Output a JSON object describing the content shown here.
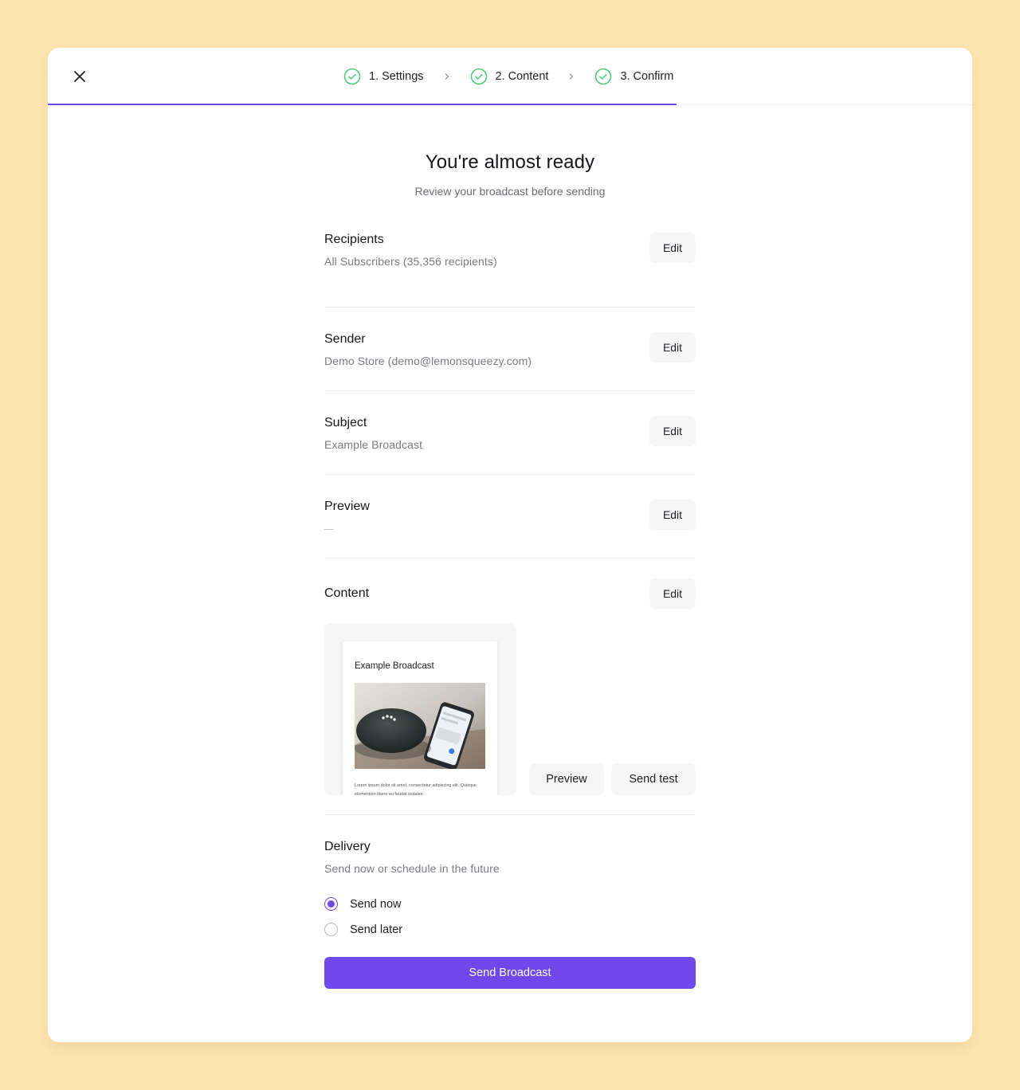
{
  "header": {
    "steps": [
      {
        "label": "1. Settings"
      },
      {
        "label": "2. Content"
      },
      {
        "label": "3. Confirm"
      }
    ],
    "progress_fraction": 0.68,
    "accent_color": "#6d4ae8",
    "check_color": "#4cc97a"
  },
  "page": {
    "title": "You're almost ready",
    "subtitle": "Review your broadcast before sending"
  },
  "sections": {
    "recipients": {
      "title": "Recipients",
      "value": "All Subscribers (35,356 recipients)",
      "edit_label": "Edit"
    },
    "sender": {
      "title": "Sender",
      "value": "Demo Store (demo@lemonsqueezy.com)",
      "edit_label": "Edit"
    },
    "subject": {
      "title": "Subject",
      "value": "Example Broadcast",
      "edit_label": "Edit"
    },
    "preview": {
      "title": "Preview",
      "edit_label": "Edit"
    },
    "content": {
      "title": "Content",
      "edit_label": "Edit",
      "email_title": "Example Broadcast",
      "email_body": "Lorem ipsum dolor sit amet, consectetur adipiscing elit. Quisque elementum libero eu feudat sodales.",
      "preview_label": "Preview",
      "send_test_label": "Send test"
    }
  },
  "delivery": {
    "title": "Delivery",
    "subtitle": "Send now or schedule in the future",
    "options": [
      {
        "label": "Send now",
        "checked": true
      },
      {
        "label": "Send later",
        "checked": false
      }
    ],
    "submit_label": "Send Broadcast"
  }
}
